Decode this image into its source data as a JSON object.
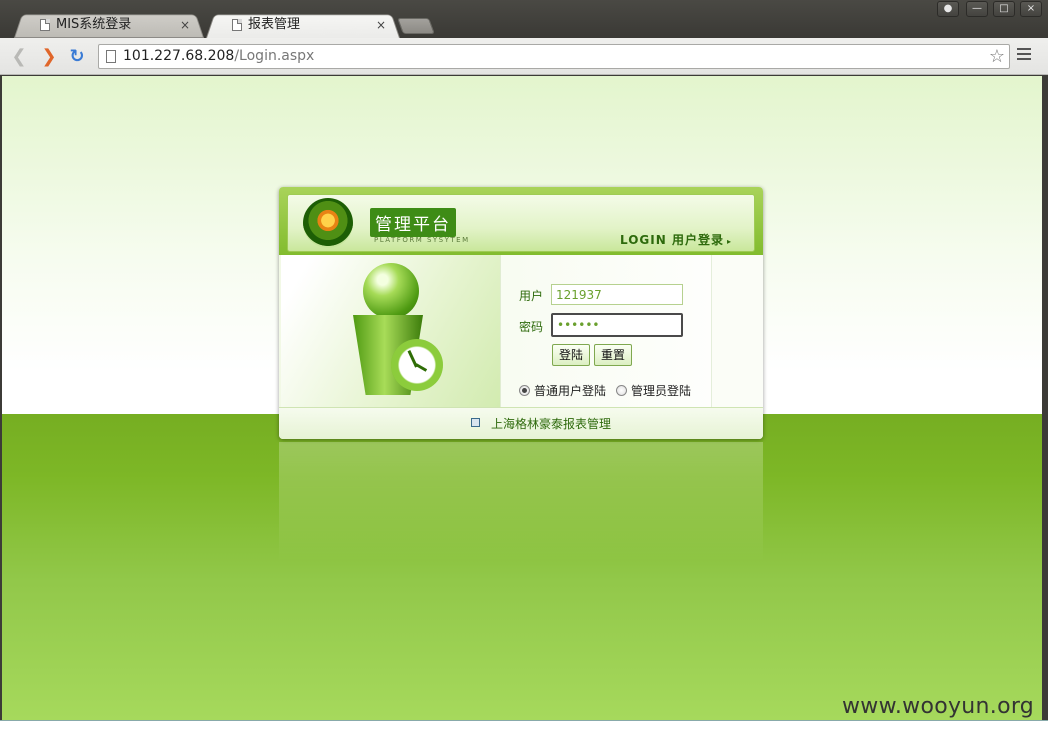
{
  "browser": {
    "tabs": [
      {
        "title": "MIS系统登录",
        "close": "×"
      },
      {
        "title": "报表管理",
        "close": "×"
      }
    ],
    "window_controls": {
      "user": "●",
      "minimize": "—",
      "maximize": "□",
      "close": "×"
    },
    "nav": {
      "back": "❮",
      "forward": "❯",
      "reload": "↻"
    },
    "url_host": "101.227.68.208",
    "url_path": "/Login.aspx",
    "bookmark": "☆"
  },
  "login": {
    "brand_title": "管理平台",
    "brand_subtitle": "PLATFORM SYSYTEM",
    "caption": "LOGIN 用户登录",
    "caption_arrow": "▸",
    "user_label": "用户",
    "user_value": "121937",
    "password_label": "密码",
    "password_value": "••••••",
    "login_button": "登陆",
    "reset_button": "重置",
    "radio_normal": "普通用户登陆",
    "radio_admin": "管理员登陆",
    "company": "上海格林豪泰报表管理",
    "selected_role": "普通用户登陆"
  },
  "watermark": "www.wooyun.org",
  "colors": {
    "accent_green": "#76ae22",
    "brand_green": "#3e8c16",
    "text_green": "#2e6a0c"
  }
}
